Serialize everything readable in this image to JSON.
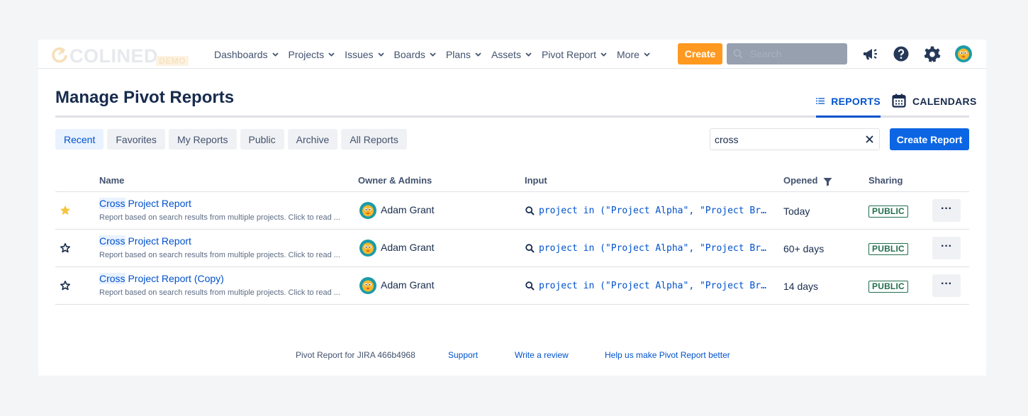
{
  "logo": {
    "word": "COLINED",
    "badge": "DEMO"
  },
  "nav": {
    "items": [
      {
        "label": "Dashboards"
      },
      {
        "label": "Projects"
      },
      {
        "label": "Issues"
      },
      {
        "label": "Boards"
      },
      {
        "label": "Plans"
      },
      {
        "label": "Assets"
      },
      {
        "label": "Pivot Report"
      },
      {
        "label": "More"
      }
    ],
    "create_label": "Create",
    "search_placeholder": "Search",
    "icons": [
      "megaphone-icon",
      "help-icon",
      "settings-icon",
      "user-avatar"
    ]
  },
  "page": {
    "title": "Manage Pivot Reports",
    "view_tabs": [
      {
        "label": "REPORTS",
        "active": true
      },
      {
        "label": "CALENDARS",
        "active": false
      }
    ]
  },
  "filters": {
    "tabs": [
      {
        "label": "Recent",
        "active": true
      },
      {
        "label": "Favorites"
      },
      {
        "label": "My Reports"
      },
      {
        "label": "Public"
      },
      {
        "label": "Archive"
      },
      {
        "label": "All Reports"
      }
    ],
    "search_value": "cross",
    "create_report_label": "Create Report"
  },
  "table": {
    "headers": {
      "name": "Name",
      "owner": "Owner & Admins",
      "input": "Input",
      "opened": "Opened",
      "sharing": "Sharing"
    },
    "rows": [
      {
        "favorite": true,
        "name_highlight": "Cross",
        "name_rest": " Project Report",
        "description": "Report based on search results from multiple projects. Click to read ...",
        "owner": "Adam Grant",
        "input": "project in (\"Project Alpha\", \"Project Br…",
        "opened": "Today",
        "sharing": "PUBLIC",
        "more": "···"
      },
      {
        "favorite": false,
        "name_highlight": "Cross",
        "name_rest": " Project Report",
        "description": "Report based on search results from multiple projects. Click to read ...",
        "owner": "Adam Grant",
        "input": "project in (\"Project Alpha\", \"Project Br…",
        "opened": "60+ days",
        "sharing": "PUBLIC",
        "more": "···"
      },
      {
        "favorite": false,
        "name_highlight": "Cross",
        "name_rest": " Project Report (Copy)",
        "description": "Report based on search results from multiple projects. Click to read ...",
        "owner": "Adam Grant",
        "input": "project in (\"Project Alpha\", \"Project Br…",
        "opened": "14 days",
        "sharing": "PUBLIC",
        "more": "···"
      }
    ]
  },
  "footer": {
    "version": "Pivot Report for JIRA 466b4968",
    "support": "Support",
    "review": "Write a review",
    "feedback": "Help us make Pivot Report better"
  },
  "colors": {
    "accent": "#0052cc",
    "create": "#ff991f",
    "primary_button": "#0c66e4",
    "public_badge": "#216e4e",
    "favorite_star": "#f5c542"
  }
}
